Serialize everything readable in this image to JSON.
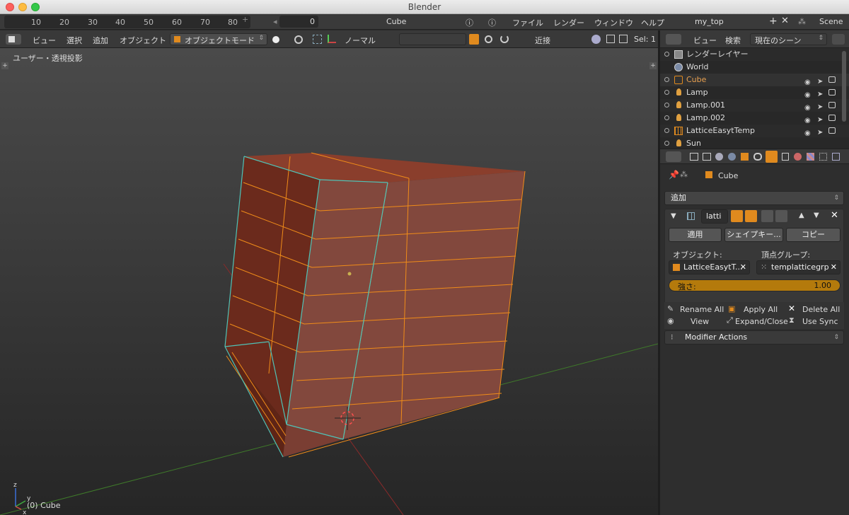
{
  "window": {
    "title": "Blender"
  },
  "topbar": {
    "ruler_ticks": [
      "10",
      "20",
      "30",
      "40",
      "50",
      "60",
      "70",
      "80"
    ],
    "frame": "0",
    "object_field": "Cube",
    "menus": [
      "ファイル",
      "レンダー",
      "ウィンドウ",
      "ヘルプ"
    ],
    "layout": "my_top",
    "scene": "Scene"
  },
  "view3d_header": {
    "menus": [
      "ビュー",
      "選択",
      "追加",
      "オブジェクト"
    ],
    "mode": "オブジェクトモード",
    "orientation": "ノーマル",
    "snap": "近接",
    "selected": "Sel: 1"
  },
  "viewport": {
    "label": "ユーザー・透視投影",
    "object": "(0) Cube",
    "axis_x": "x",
    "axis_y": "y",
    "axis_z": "z"
  },
  "outliner": {
    "menus": [
      "ビュー",
      "検索"
    ],
    "scene_filter": "現在のシーン",
    "items": [
      {
        "label": "レンダーレイヤー"
      },
      {
        "label": "World"
      },
      {
        "label": "Cube"
      },
      {
        "label": "Lamp"
      },
      {
        "label": "Lamp.001"
      },
      {
        "label": "Lamp.002"
      },
      {
        "label": "LatticeEasytTemp"
      },
      {
        "label": "Sun"
      }
    ]
  },
  "properties": {
    "context_object": "Cube",
    "add_modifier": "追加",
    "modifier_name": "latti",
    "apply": "適用",
    "shape_key": "シェイプキー...",
    "copy": "コピー",
    "object_label": "オブジェクト:",
    "vgroup_label": "頂点グループ:",
    "object_value": "LatticeEasytT...",
    "vgroup_value": "templatticegrp",
    "strength_label": "強さ:",
    "strength_value": "1.00",
    "actions": {
      "rename_all": "Rename All",
      "apply_all": "Apply All",
      "delete_all": "Delete All",
      "view": "View",
      "expand_close": "Expand/Close",
      "use_sync": "Use Sync",
      "modifier_actions": "Modifier Actions"
    }
  },
  "colors": {
    "accent_orange": "#e08a1e",
    "cube_face": "#7a3a2a",
    "edge_orange": "#f08c19",
    "edge_teal": "#4fc3b7"
  }
}
